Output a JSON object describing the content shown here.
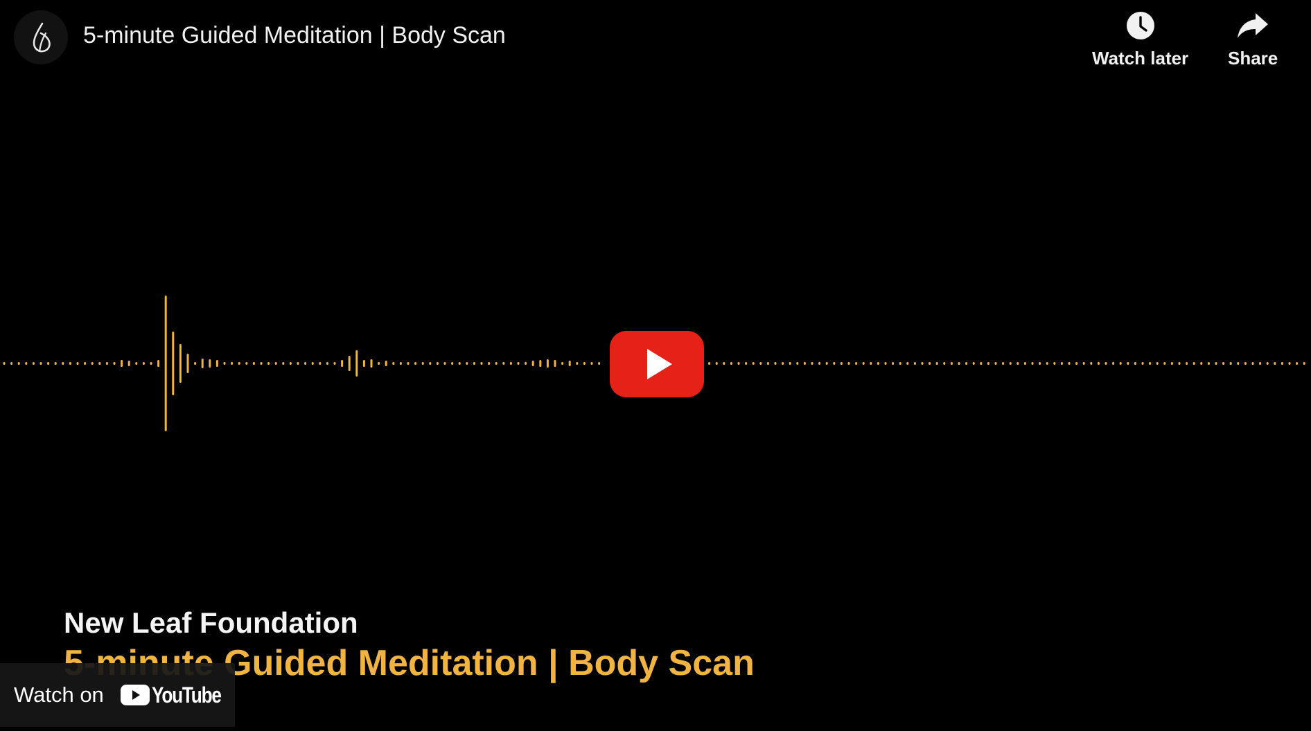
{
  "header": {
    "title": "5-minute Guided Meditation | Body Scan",
    "channel_icon": "leaf-logo-icon"
  },
  "actions": {
    "watch_later_label": "Watch later",
    "watch_later_icon": "clock-icon",
    "share_label": "Share",
    "share_icon": "share-arrow-icon"
  },
  "overlay": {
    "channel_name": "New Leaf Foundation",
    "video_title": "5-minute Guided Meditation | Body Scan"
  },
  "play_button": {
    "icon": "play-icon",
    "color": "#e62117"
  },
  "footer": {
    "watch_on_label": "Watch on",
    "brand_wordmark": "YouTube",
    "brand_icon": "youtube-logo-icon"
  },
  "colors": {
    "background": "#000000",
    "waveform": "#f2b441",
    "text": "#f1f1f1"
  }
}
